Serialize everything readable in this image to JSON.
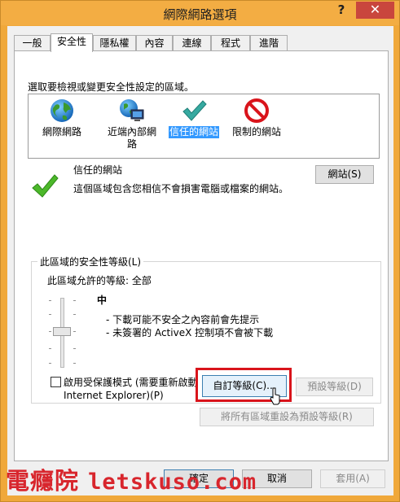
{
  "window": {
    "title": "網際網路選項",
    "help_label": "?",
    "close_label": "✕"
  },
  "tabs": [
    {
      "label": "一般",
      "active": false
    },
    {
      "label": "安全性",
      "active": true
    },
    {
      "label": "隱私權",
      "active": false
    },
    {
      "label": "內容",
      "active": false
    },
    {
      "label": "連線",
      "active": false
    },
    {
      "label": "程式",
      "active": false
    },
    {
      "label": "進階",
      "active": false
    }
  ],
  "security": {
    "zone_prompt": "選取要檢視或變更安全性設定的區域。",
    "zones": [
      {
        "label": "網際網路",
        "icon": "globe-icon",
        "selected": false
      },
      {
        "label": "近端內部網",
        "label2": "路",
        "icon": "intranet-icon",
        "selected": false
      },
      {
        "label": "信任的網站",
        "icon": "checkmark-icon",
        "selected": true
      },
      {
        "label": "限制的網站",
        "icon": "restricted-icon",
        "selected": false
      }
    ],
    "selected_zone_title": "信任的網站",
    "selected_zone_desc": "這個區域包含您相信不會損害電腦或檔案的網站。",
    "sites_button": "網站(S)",
    "level_group_title": "此區域的安全性等級(L)",
    "allowed_levels": "此區域允許的等級: 全部",
    "level_name": "中",
    "level_bullets": [
      "- 下載可能不安全之內容前會先提示",
      "- 未簽署的 ActiveX 控制項不會被下載"
    ],
    "protected_mode_label": "啟用受保護模式 (需要重新啟動",
    "protected_mode_label2": "Internet Explorer)(P)",
    "custom_level_button": "自訂等級(C)...",
    "default_level_button": "預設等級(D)",
    "reset_all_button": "將所有區域重設為預設等級(R)"
  },
  "footer": {
    "ok": "確定",
    "cancel": "取消",
    "apply": "套用(A)"
  },
  "watermark": {
    "cjk": "電癮院",
    "latin": "letskuso.com"
  },
  "colors": {
    "titlebar": "#f3ad43",
    "close": "#c9463d",
    "selection": "#3399ff",
    "highlight_box": "#d9141b"
  }
}
